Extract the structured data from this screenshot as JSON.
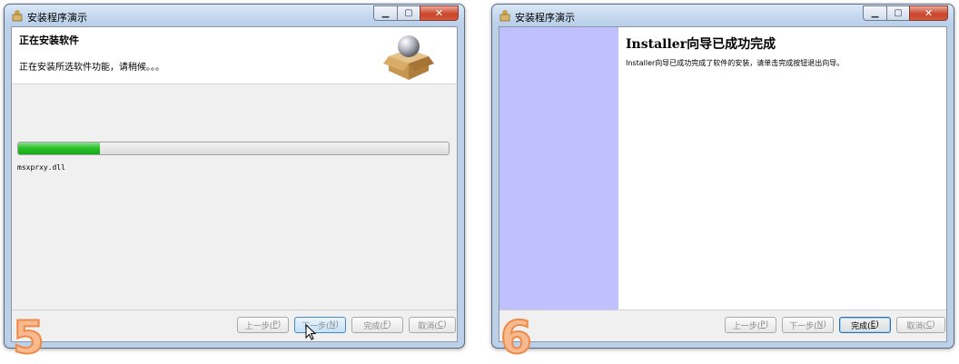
{
  "window5": {
    "title": "安装程序演示",
    "header_title": "正在安装软件",
    "header_desc": "正在安装所选软件功能，请稍候。。。",
    "progress_fraction": 0.19,
    "current_file": "msxprxy.dll",
    "buttons": {
      "back": "上一步(",
      "back_key": "P",
      "next": "下一步(",
      "next_key": "N",
      "finish": "完成(",
      "finish_key": "F",
      "cancel": "取消(",
      "cancel_key": "C",
      "close_paren": ")"
    },
    "step_number": "5"
  },
  "window6": {
    "title": "安装程序演示",
    "finish_title": "Installer向导已成功完成",
    "finish_desc": "Installer向导已成功完成了软件的安装，请单击完成按钮退出向导。",
    "buttons": {
      "back": "上一步(",
      "back_key": "P",
      "next": "下一步(",
      "next_key": "N",
      "finish": "完成(",
      "finish_key": "E",
      "cancel": "取消(",
      "cancel_key": "C",
      "close_paren": ")"
    },
    "step_number": "6"
  },
  "colors": {
    "progress": "#22b422",
    "side_panel": "#c0c0ff",
    "step_number": "#f0964f"
  },
  "icons": {
    "app": "installer-icon",
    "header": "package-box-icon"
  }
}
